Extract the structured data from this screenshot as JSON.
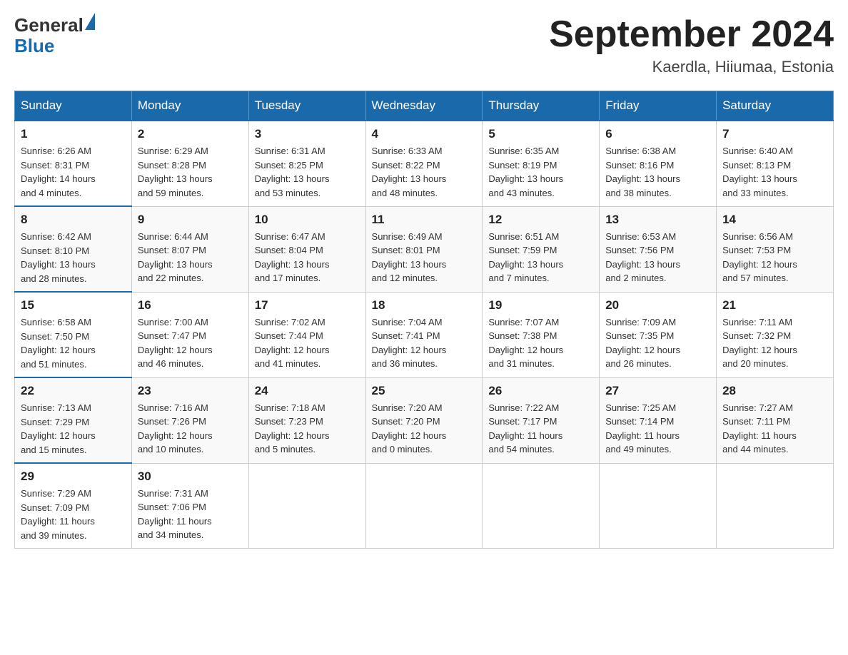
{
  "header": {
    "logo_general": "General",
    "logo_blue": "Blue",
    "month_title": "September 2024",
    "location": "Kaerdla, Hiiumaa, Estonia"
  },
  "calendar": {
    "days_of_week": [
      "Sunday",
      "Monday",
      "Tuesday",
      "Wednesday",
      "Thursday",
      "Friday",
      "Saturday"
    ],
    "weeks": [
      [
        {
          "day": "1",
          "sunrise": "6:26 AM",
          "sunset": "8:31 PM",
          "daylight": "14 hours and 4 minutes."
        },
        {
          "day": "2",
          "sunrise": "6:29 AM",
          "sunset": "8:28 PM",
          "daylight": "13 hours and 59 minutes."
        },
        {
          "day": "3",
          "sunrise": "6:31 AM",
          "sunset": "8:25 PM",
          "daylight": "13 hours and 53 minutes."
        },
        {
          "day": "4",
          "sunrise": "6:33 AM",
          "sunset": "8:22 PM",
          "daylight": "13 hours and 48 minutes."
        },
        {
          "day": "5",
          "sunrise": "6:35 AM",
          "sunset": "8:19 PM",
          "daylight": "13 hours and 43 minutes."
        },
        {
          "day": "6",
          "sunrise": "6:38 AM",
          "sunset": "8:16 PM",
          "daylight": "13 hours and 38 minutes."
        },
        {
          "day": "7",
          "sunrise": "6:40 AM",
          "sunset": "8:13 PM",
          "daylight": "13 hours and 33 minutes."
        }
      ],
      [
        {
          "day": "8",
          "sunrise": "6:42 AM",
          "sunset": "8:10 PM",
          "daylight": "13 hours and 28 minutes."
        },
        {
          "day": "9",
          "sunrise": "6:44 AM",
          "sunset": "8:07 PM",
          "daylight": "13 hours and 22 minutes."
        },
        {
          "day": "10",
          "sunrise": "6:47 AM",
          "sunset": "8:04 PM",
          "daylight": "13 hours and 17 minutes."
        },
        {
          "day": "11",
          "sunrise": "6:49 AM",
          "sunset": "8:01 PM",
          "daylight": "13 hours and 12 minutes."
        },
        {
          "day": "12",
          "sunrise": "6:51 AM",
          "sunset": "7:59 PM",
          "daylight": "13 hours and 7 minutes."
        },
        {
          "day": "13",
          "sunrise": "6:53 AM",
          "sunset": "7:56 PM",
          "daylight": "13 hours and 2 minutes."
        },
        {
          "day": "14",
          "sunrise": "6:56 AM",
          "sunset": "7:53 PM",
          "daylight": "12 hours and 57 minutes."
        }
      ],
      [
        {
          "day": "15",
          "sunrise": "6:58 AM",
          "sunset": "7:50 PM",
          "daylight": "12 hours and 51 minutes."
        },
        {
          "day": "16",
          "sunrise": "7:00 AM",
          "sunset": "7:47 PM",
          "daylight": "12 hours and 46 minutes."
        },
        {
          "day": "17",
          "sunrise": "7:02 AM",
          "sunset": "7:44 PM",
          "daylight": "12 hours and 41 minutes."
        },
        {
          "day": "18",
          "sunrise": "7:04 AM",
          "sunset": "7:41 PM",
          "daylight": "12 hours and 36 minutes."
        },
        {
          "day": "19",
          "sunrise": "7:07 AM",
          "sunset": "7:38 PM",
          "daylight": "12 hours and 31 minutes."
        },
        {
          "day": "20",
          "sunrise": "7:09 AM",
          "sunset": "7:35 PM",
          "daylight": "12 hours and 26 minutes."
        },
        {
          "day": "21",
          "sunrise": "7:11 AM",
          "sunset": "7:32 PM",
          "daylight": "12 hours and 20 minutes."
        }
      ],
      [
        {
          "day": "22",
          "sunrise": "7:13 AM",
          "sunset": "7:29 PM",
          "daylight": "12 hours and 15 minutes."
        },
        {
          "day": "23",
          "sunrise": "7:16 AM",
          "sunset": "7:26 PM",
          "daylight": "12 hours and 10 minutes."
        },
        {
          "day": "24",
          "sunrise": "7:18 AM",
          "sunset": "7:23 PM",
          "daylight": "12 hours and 5 minutes."
        },
        {
          "day": "25",
          "sunrise": "7:20 AM",
          "sunset": "7:20 PM",
          "daylight": "12 hours and 0 minutes."
        },
        {
          "day": "26",
          "sunrise": "7:22 AM",
          "sunset": "7:17 PM",
          "daylight": "11 hours and 54 minutes."
        },
        {
          "day": "27",
          "sunrise": "7:25 AM",
          "sunset": "7:14 PM",
          "daylight": "11 hours and 49 minutes."
        },
        {
          "day": "28",
          "sunrise": "7:27 AM",
          "sunset": "7:11 PM",
          "daylight": "11 hours and 44 minutes."
        }
      ],
      [
        {
          "day": "29",
          "sunrise": "7:29 AM",
          "sunset": "7:09 PM",
          "daylight": "11 hours and 39 minutes."
        },
        {
          "day": "30",
          "sunrise": "7:31 AM",
          "sunset": "7:06 PM",
          "daylight": "11 hours and 34 minutes."
        },
        null,
        null,
        null,
        null,
        null
      ]
    ]
  }
}
